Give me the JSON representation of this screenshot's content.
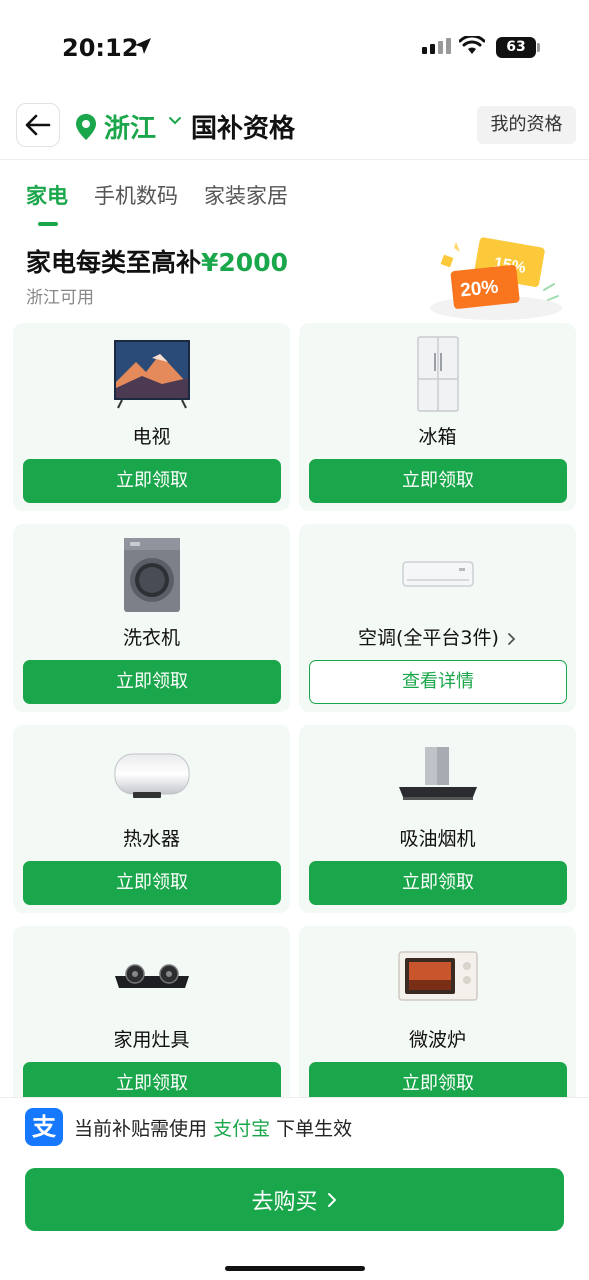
{
  "status_bar": {
    "time": "20:12",
    "battery": "63"
  },
  "header": {
    "province": "浙江",
    "title": "国补资格",
    "my_qualification": "我的资格"
  },
  "tabs": [
    {
      "label": "家电",
      "active": true
    },
    {
      "label": "手机数码",
      "active": false
    },
    {
      "label": "家装家居",
      "active": false
    }
  ],
  "promo": {
    "title": "家电每类至高补",
    "amount": "¥2000",
    "subtitle": "浙江可用",
    "coupon_front": "20%",
    "coupon_back": "15%"
  },
  "products": [
    {
      "name": "电视",
      "action": "立即领取",
      "icon": "tv-icon"
    },
    {
      "name": "冰箱",
      "action": "立即领取",
      "icon": "fridge-icon"
    },
    {
      "name": "洗衣机",
      "action": "立即领取",
      "icon": "washing-machine-icon"
    },
    {
      "name": "空调(全平台3件)",
      "action": "查看详情",
      "icon": "air-conditioner-icon"
    },
    {
      "name": "热水器",
      "action": "立即领取",
      "icon": "water-heater-icon"
    },
    {
      "name": "吸油烟机",
      "action": "立即领取",
      "icon": "range-hood-icon"
    },
    {
      "name": "家用灶具",
      "action": "立即领取",
      "icon": "gas-stove-icon"
    },
    {
      "name": "微波炉",
      "action": "立即领取",
      "icon": "microwave-icon"
    }
  ],
  "bottom": {
    "alipay_glyph": "支",
    "notice_prefix": "当前补贴需使用",
    "notice_brand": "支付宝",
    "notice_suffix": "下单生效",
    "buy_label": "去购买"
  },
  "colors": {
    "accent": "#1aa64a",
    "card_bg": "#f3f9f4",
    "alipay_blue": "#1677ff"
  }
}
